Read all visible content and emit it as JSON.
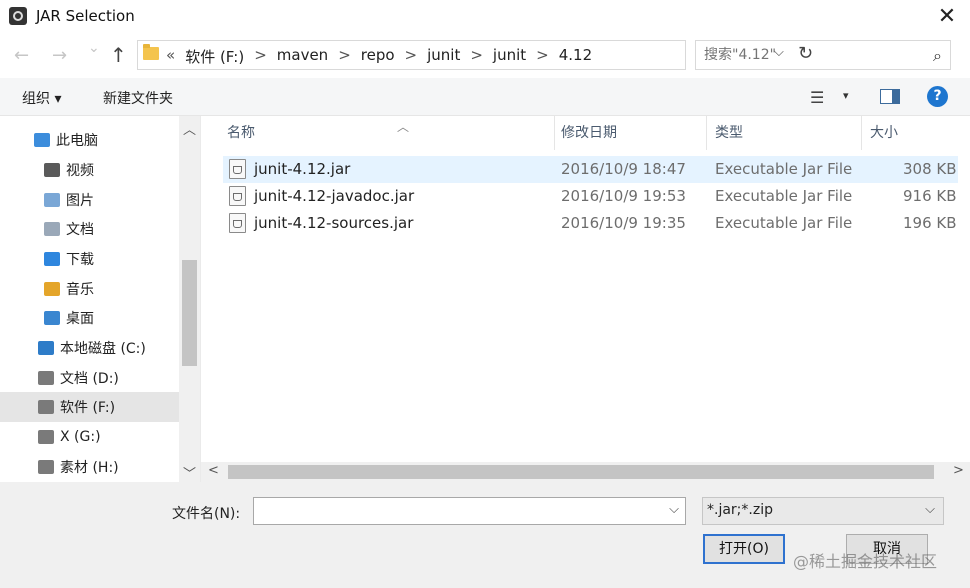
{
  "window": {
    "title": "JAR Selection",
    "close": "✕"
  },
  "address": {
    "back": "←",
    "forward": "→",
    "history": "⌄",
    "up": "↑",
    "prefix": "«",
    "crumbs": [
      "软件 (F:)",
      "maven",
      "repo",
      "junit",
      "junit",
      "4.12"
    ],
    "separator": ">",
    "search_placeholder": "搜索\"4.12\""
  },
  "toolbar": {
    "organize": "组织 ▾",
    "new_folder": "新建文件夹",
    "help": "?"
  },
  "nav": {
    "items": [
      {
        "label": "此电脑",
        "icon": "computer-icon",
        "color": "#3c8ddc"
      },
      {
        "label": "视频",
        "icon": "videos-folder-icon",
        "color": "#5a5a5a"
      },
      {
        "label": "图片",
        "icon": "pictures-folder-icon",
        "color": "#7aa7d6"
      },
      {
        "label": "文档",
        "icon": "documents-folder-icon",
        "color": "#9aa8b8"
      },
      {
        "label": "下载",
        "icon": "downloads-folder-icon",
        "color": "#2e86de"
      },
      {
        "label": "音乐",
        "icon": "music-folder-icon",
        "color": "#e4a52a"
      },
      {
        "label": "桌面",
        "icon": "desktop-folder-icon",
        "color": "#3a86d0"
      },
      {
        "label": "本地磁盘 (C:)",
        "icon": "windows-drive-icon",
        "color": "#2e7cc8"
      },
      {
        "label": "文档 (D:)",
        "icon": "drive-icon",
        "color": "#7a7a7a"
      },
      {
        "label": "软件 (F:)",
        "icon": "drive-icon",
        "color": "#7a7a7a"
      },
      {
        "label": "X (G:)",
        "icon": "drive-icon",
        "color": "#7a7a7a"
      },
      {
        "label": "素材 (H:)",
        "icon": "drive-icon",
        "color": "#7a7a7a"
      }
    ],
    "selected_index": 9
  },
  "columns": {
    "name": "名称",
    "modified": "修改日期",
    "type": "类型",
    "size": "大小"
  },
  "files": [
    {
      "name": "junit-4.12.jar",
      "modified": "2016/10/9 18:47",
      "type": "Executable Jar File",
      "size": "308 KB"
    },
    {
      "name": "junit-4.12-javadoc.jar",
      "modified": "2016/10/9 19:53",
      "type": "Executable Jar File",
      "size": "916 KB"
    },
    {
      "name": "junit-4.12-sources.jar",
      "modified": "2016/10/9 19:35",
      "type": "Executable Jar File",
      "size": "196 KB"
    }
  ],
  "footer": {
    "filename_label": "文件名(N):",
    "filename_value": "",
    "filter": "*.jar;*.zip",
    "open": "打开(O)",
    "cancel": "取消"
  },
  "watermark": "@稀土掘金技术社区"
}
